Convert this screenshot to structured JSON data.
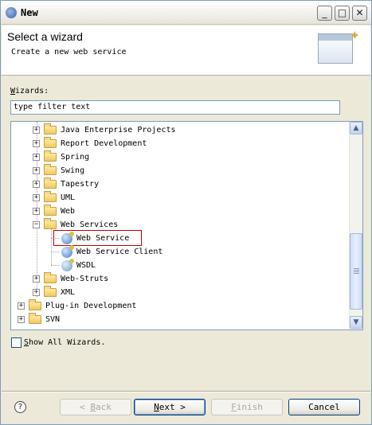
{
  "window": {
    "title": "New"
  },
  "title_buttons": [
    "_",
    "□",
    "✕"
  ],
  "banner": {
    "title": "Select a wizard",
    "description": "Create a new web service"
  },
  "wizards_label_key": "W",
  "wizards_label_rest": "izards:",
  "filter": {
    "value": "type filter text"
  },
  "tree": {
    "items": [
      {
        "label": "Java Enterprise Projects",
        "icon": "folder-icon",
        "expander": "+"
      },
      {
        "label": "Report Development",
        "icon": "folder-icon",
        "expander": "+"
      },
      {
        "label": "Spring",
        "icon": "folder-icon",
        "expander": "+"
      },
      {
        "label": "Swing",
        "icon": "folder-icon",
        "expander": "+"
      },
      {
        "label": "Tapestry",
        "icon": "folder-icon",
        "expander": "+"
      },
      {
        "label": "UML",
        "icon": "folder-icon",
        "expander": "+"
      },
      {
        "label": "Web",
        "icon": "folder-icon",
        "expander": "+"
      },
      {
        "label": "Web Services",
        "icon": "folder-icon",
        "expander": "−"
      },
      {
        "label": "Web Service",
        "icon": "web-service-icon"
      },
      {
        "label": "Web Service Client",
        "icon": "web-service-client-icon"
      },
      {
        "label": "WSDL",
        "icon": "wsdl-icon"
      },
      {
        "label": "Web-Struts",
        "icon": "folder-icon",
        "expander": "+"
      },
      {
        "label": "XML",
        "icon": "folder-icon",
        "expander": "+"
      },
      {
        "label": "Plug-in Development",
        "icon": "folder-icon",
        "expander": "+"
      },
      {
        "label": "SVN",
        "icon": "folder-icon",
        "expander": "+"
      }
    ],
    "selected": "Web Service"
  },
  "show_all_key": "S",
  "show_all_rest": "how All Wizards.",
  "help_icon": "?",
  "buttons": {
    "back_arrow": "< ",
    "back_key": "B",
    "back_rest": "ack",
    "next_key": "N",
    "next_rest": "ext >",
    "finish_key": "F",
    "finish_rest": "inish",
    "cancel": "Cancel"
  },
  "colors": {
    "selection_outline": "#c00000",
    "window_bg": "#ece9d8"
  }
}
